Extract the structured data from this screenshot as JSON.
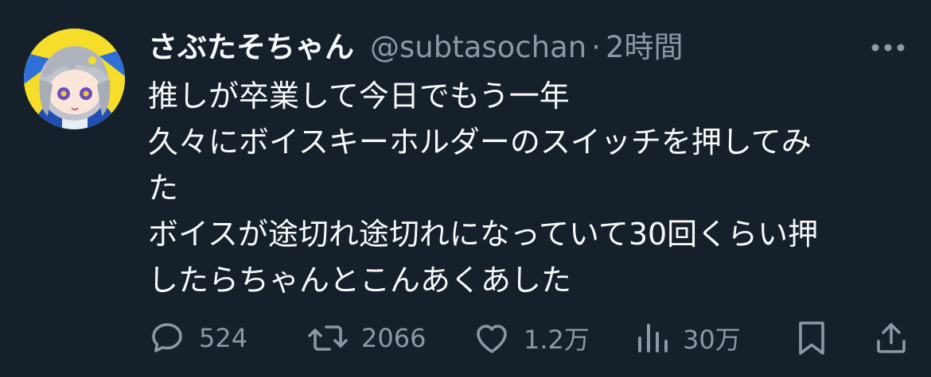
{
  "tweet": {
    "display_name": "さぶたそちゃん",
    "handle": "@subtasochan",
    "separator": "·",
    "time": "2時間",
    "lines": [
      "推しが卒業して今日でもう一年",
      "久々にボイスキーホルダーのスイッチを押してみ",
      "た",
      "ボイスが途切れ途切れになっていて30回くらい押",
      "したらちゃんとこんあくあした"
    ]
  },
  "actions": {
    "replies": "524",
    "retweets": "2066",
    "likes": "1.2万",
    "views": "30万"
  },
  "icons": {
    "more": "more-horizontal-icon",
    "reply": "reply-bubble-icon",
    "retweet": "retweet-icon",
    "like": "heart-icon",
    "views": "views-bar-chart-icon",
    "bookmark": "bookmark-icon",
    "share": "share-upload-icon"
  },
  "colors": {
    "background": "#15202b",
    "text": "#f7f9f9",
    "secondary_text": "#8b98a5",
    "avatar_background": "#f5dd2a"
  }
}
